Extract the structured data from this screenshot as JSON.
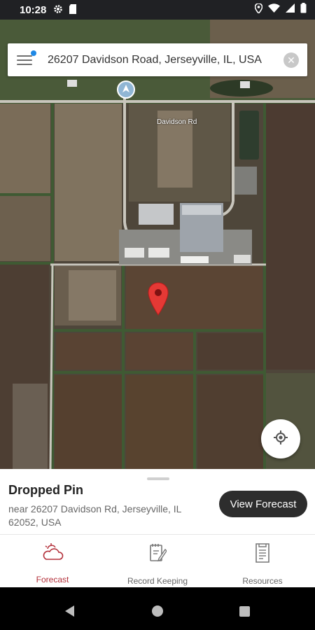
{
  "status_bar": {
    "time": "10:28",
    "left_icons": [
      "gear-icon",
      "sd-card-icon"
    ],
    "right_icons": [
      "location-icon",
      "wifi-icon",
      "signal-icon",
      "battery-icon"
    ]
  },
  "search": {
    "value": "26207 Davidson Road, Jerseyville, IL, USA",
    "menu_icon": "menu-icon",
    "clear_icon": "clear-icon"
  },
  "map": {
    "road_label": "Davidson Rd",
    "marker_color": "#e53935",
    "marker_icon": "map-pin-icon",
    "locate_icon": "my-location-icon"
  },
  "dropped_pin": {
    "title": "Dropped Pin",
    "address": "near 26207 Davidson Rd, Jerseyville, IL 62052, USA",
    "button_label": "View Forecast"
  },
  "bottom_nav": {
    "accent_color": "#b3303a",
    "items": [
      {
        "label": "Forecast",
        "icon": "cloud-sun-icon",
        "active": true
      },
      {
        "label": "Record Keeping",
        "icon": "notebook-icon",
        "active": false
      },
      {
        "label": "Resources",
        "icon": "document-icon",
        "active": false
      }
    ]
  }
}
